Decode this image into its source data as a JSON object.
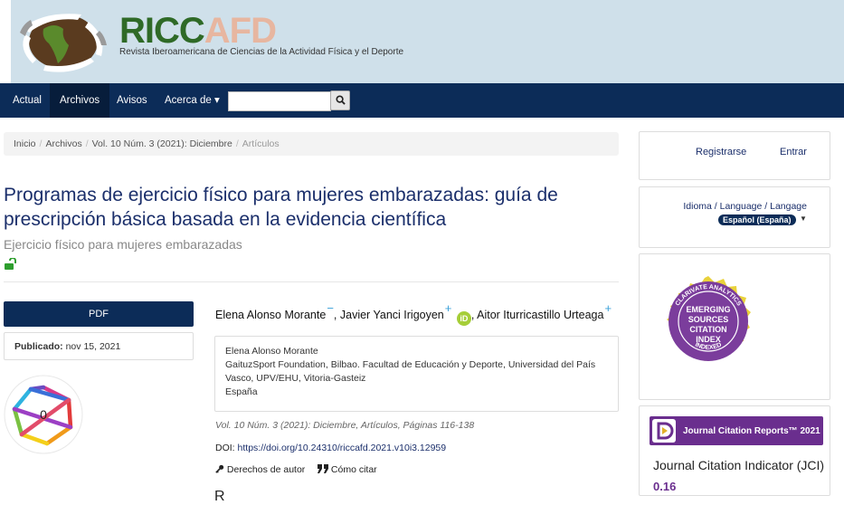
{
  "header": {
    "logo_main": "RICC",
    "logo_accent": "AFD",
    "logo_subtitle": "Revista Iberoamericana de Ciencias de la Actividad Física y el Deporte"
  },
  "nav": {
    "items": [
      "Actual",
      "Archivos",
      "Avisos",
      "Acerca de"
    ],
    "active": "Archivos",
    "dropdown_caret": "▾",
    "search_placeholder": "",
    "search_icon": "search-icon"
  },
  "breadcrumb": {
    "items": [
      "Inicio",
      "Archivos",
      "Vol. 10 Núm. 3 (2021): Diciembre",
      "Artículos"
    ],
    "separator": "/"
  },
  "article": {
    "title": "Programas de ejercicio físico para mujeres embarazadas: guía de prescripción básica basada en la evidencia científica",
    "subtitle": "Ejercicio físico para mujeres embarazadas",
    "open_access_icon": "unlock-icon",
    "pdf_label": "PDF",
    "published_label": "Publicado:",
    "published_date": "nov 15, 2021",
    "dimensions_count": "0",
    "authors": [
      {
        "name": "Elena Alonso Morante",
        "toggle": "−"
      },
      {
        "name": "Javier Yanci Irigoyen",
        "toggle": "+",
        "orcid": "iD"
      },
      {
        "name": "Aitor Iturricastillo Urteaga",
        "toggle": "+"
      }
    ],
    "author_separator": ",",
    "affiliation": {
      "name": "Elena Alonso Morante",
      "institution": "GaituzSport Foundation, Bilbao. Facultad de Educación y Deporte, Universidad del País Vasco, UPV/EHU, Vitoria-Gasteiz",
      "country": "España"
    },
    "issue_line": "Vol. 10 Núm. 3 (2021): Diciembre, Artículos, Páginas 116-138",
    "doi_label": "DOI:",
    "doi_url": "https://doi.org/10.24310/riccafd.2021.v10i3.12959",
    "copyright_label": "Derechos de autor",
    "cite_label": "Cómo citar",
    "next_heading": "R"
  },
  "sidebar": {
    "register": "Registrarse",
    "login": "Entrar",
    "language_title": "Idioma / Language / Langage",
    "language_current": "Español (España)",
    "esci": {
      "top": "CLARIVATE ANALYTICS",
      "line1": "EMERGING",
      "line2": "SOURCES",
      "line3": "CITATION",
      "line4": "INDEX",
      "bottom": "INDEXED"
    },
    "jcr_banner": "Journal Citation Reports™ 2021",
    "jci_label": "Journal Citation Indicator (JCI)",
    "jci_value": "0.16"
  },
  "colors": {
    "nav_bg": "#0c2c58",
    "title": "#1b2f6b",
    "jcr_purple": "#6a2e8e",
    "esci_purple": "#7b3d9c",
    "orcid_green": "#a6ce39"
  }
}
